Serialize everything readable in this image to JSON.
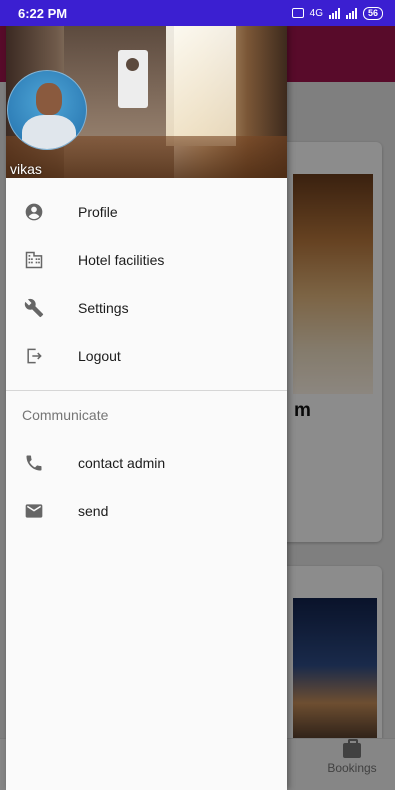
{
  "status_bar": {
    "time": "6:22 PM",
    "network_label": "4G",
    "battery": "56"
  },
  "app": {
    "card_title_partial": "m",
    "bottom_nav": {
      "bookings_label": "Bookings"
    }
  },
  "drawer": {
    "username": "vikas",
    "items": [
      {
        "label": "Profile",
        "icon": "account-circle-icon"
      },
      {
        "label": "Hotel facilities",
        "icon": "building-icon"
      },
      {
        "label": "Settings",
        "icon": "wrench-icon"
      },
      {
        "label": "Logout",
        "icon": "logout-icon"
      }
    ],
    "section_title": "Communicate",
    "comm_items": [
      {
        "label": "contact admin",
        "icon": "phone-icon"
      },
      {
        "label": "send",
        "icon": "mail-icon"
      }
    ]
  },
  "colors": {
    "status_bar": "#3b1fd1",
    "app_bar": "#a0154e",
    "drawer_bg": "#fafafa",
    "icon": "#666666"
  }
}
